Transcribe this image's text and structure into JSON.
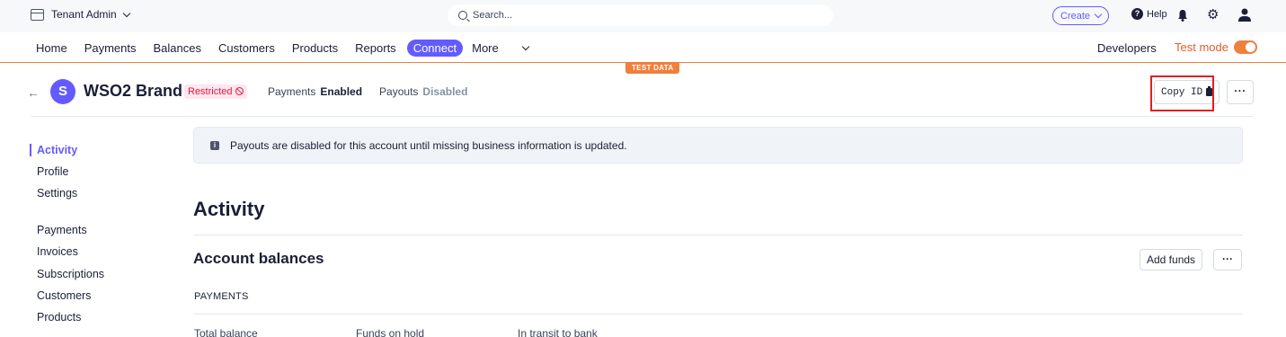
{
  "topbar": {
    "tenant_label": "Tenant Admin",
    "search_placeholder": "Search...",
    "create_label": "Create",
    "help_label": "Help"
  },
  "nav": {
    "items": [
      "Home",
      "Payments",
      "Balances",
      "Customers",
      "Products",
      "Reports"
    ],
    "connect_label": "Connect",
    "more_label": "More",
    "developers_label": "Developers",
    "test_mode_label": "Test mode",
    "test_data_badge": "TEST DATA"
  },
  "account": {
    "logo_letter": "S",
    "name": "WSO2 Brand",
    "restricted_label": "Restricted",
    "payments_label": "Payments",
    "payments_status": "Enabled",
    "payouts_label": "Payouts",
    "payouts_status": "Disabled",
    "copy_id_label": "Copy ID",
    "more_label": "···"
  },
  "sidebar": {
    "activity": "Activity",
    "profile": "Profile",
    "settings": "Settings",
    "payments": "Payments",
    "invoices": "Invoices",
    "subscriptions": "Subscriptions",
    "customers": "Customers",
    "products": "Products"
  },
  "main": {
    "banner_text": "Payouts are disabled for this account until missing business information is updated.",
    "activity_heading": "Activity",
    "balances_heading": "Account balances",
    "add_funds_label": "Add funds",
    "more_label": "···",
    "payments_subheading": "PAYMENTS",
    "columns": [
      "Total balance",
      "Funds on hold",
      "In transit to bank"
    ]
  },
  "colors": {
    "accent": "#635bff",
    "test_mode": "#f07f3c",
    "restricted": "#df1b41",
    "highlight": "#e02020"
  }
}
